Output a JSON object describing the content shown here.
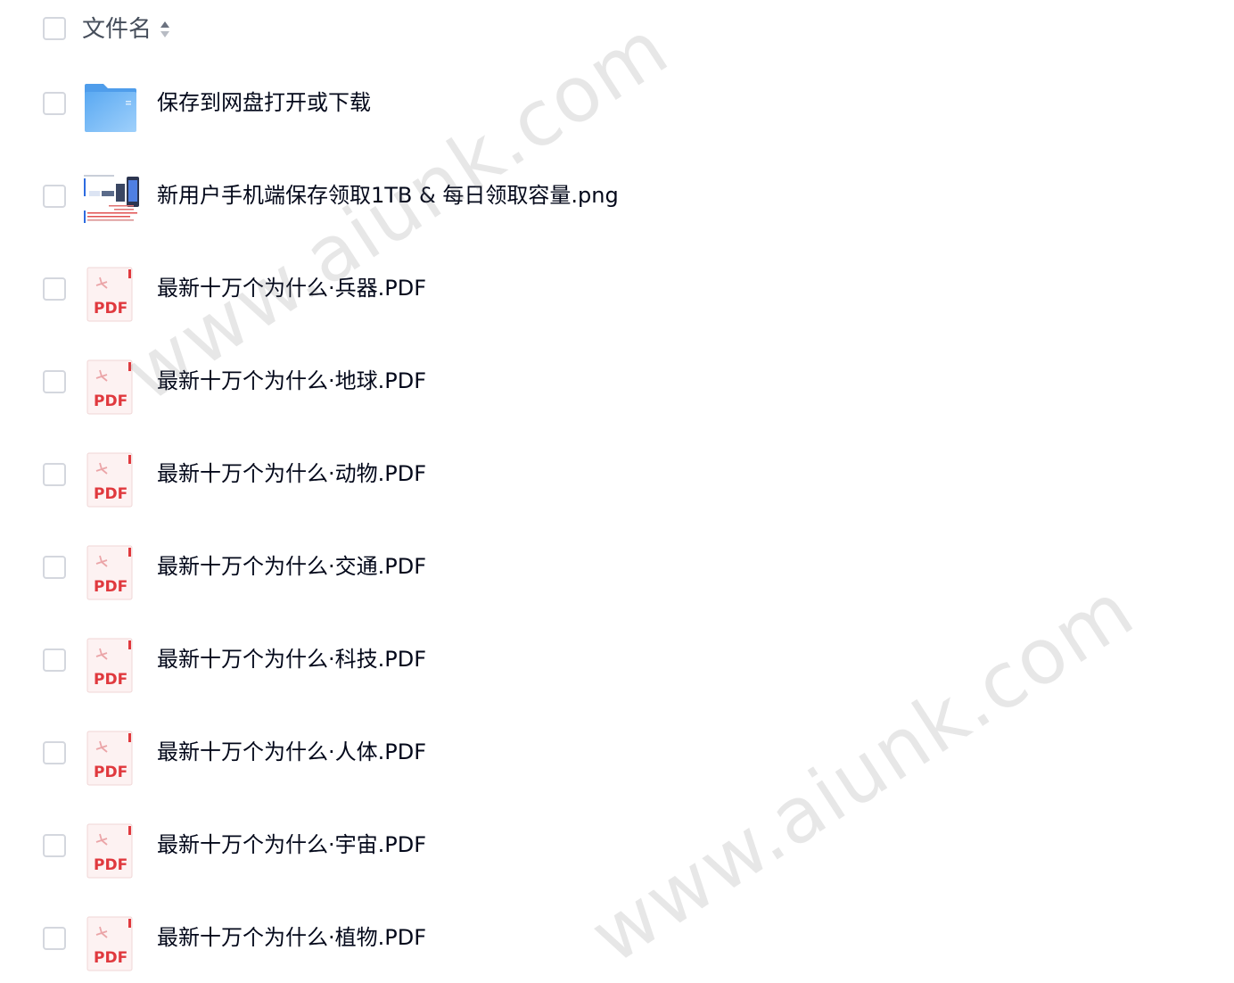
{
  "header": {
    "title": "文件名",
    "sort_icon": "sort-icon"
  },
  "files": [
    {
      "name": "保存到网盘打开或下载",
      "type": "folder",
      "icon": "folder-icon"
    },
    {
      "name": "新用户手机端保存领取1TB & 每日领取容量.png",
      "type": "image",
      "icon": "image-thumbnail"
    },
    {
      "name": "最新十万个为什么·兵器.PDF",
      "type": "pdf",
      "icon": "pdf-icon",
      "icon_label": "PDF"
    },
    {
      "name": "最新十万个为什么·地球.PDF",
      "type": "pdf",
      "icon": "pdf-icon",
      "icon_label": "PDF"
    },
    {
      "name": "最新十万个为什么·动物.PDF",
      "type": "pdf",
      "icon": "pdf-icon",
      "icon_label": "PDF"
    },
    {
      "name": "最新十万个为什么·交通.PDF",
      "type": "pdf",
      "icon": "pdf-icon",
      "icon_label": "PDF"
    },
    {
      "name": "最新十万个为什么·科技.PDF",
      "type": "pdf",
      "icon": "pdf-icon",
      "icon_label": "PDF"
    },
    {
      "name": "最新十万个为什么·人体.PDF",
      "type": "pdf",
      "icon": "pdf-icon",
      "icon_label": "PDF"
    },
    {
      "name": "最新十万个为什么·宇宙.PDF",
      "type": "pdf",
      "icon": "pdf-icon",
      "icon_label": "PDF"
    },
    {
      "name": "最新十万个为什么·植物.PDF",
      "type": "pdf",
      "icon": "pdf-icon",
      "icon_label": "PDF"
    }
  ],
  "watermark": {
    "text_1": "www.aiunk.com",
    "text_2": "www.aiunk.com"
  },
  "colors": {
    "text": "#03081a",
    "header_text": "#454d5a",
    "checkbox_border": "#d4d7de",
    "folder_blue": "#6fb6f5",
    "pdf_red": "#e0393e"
  }
}
